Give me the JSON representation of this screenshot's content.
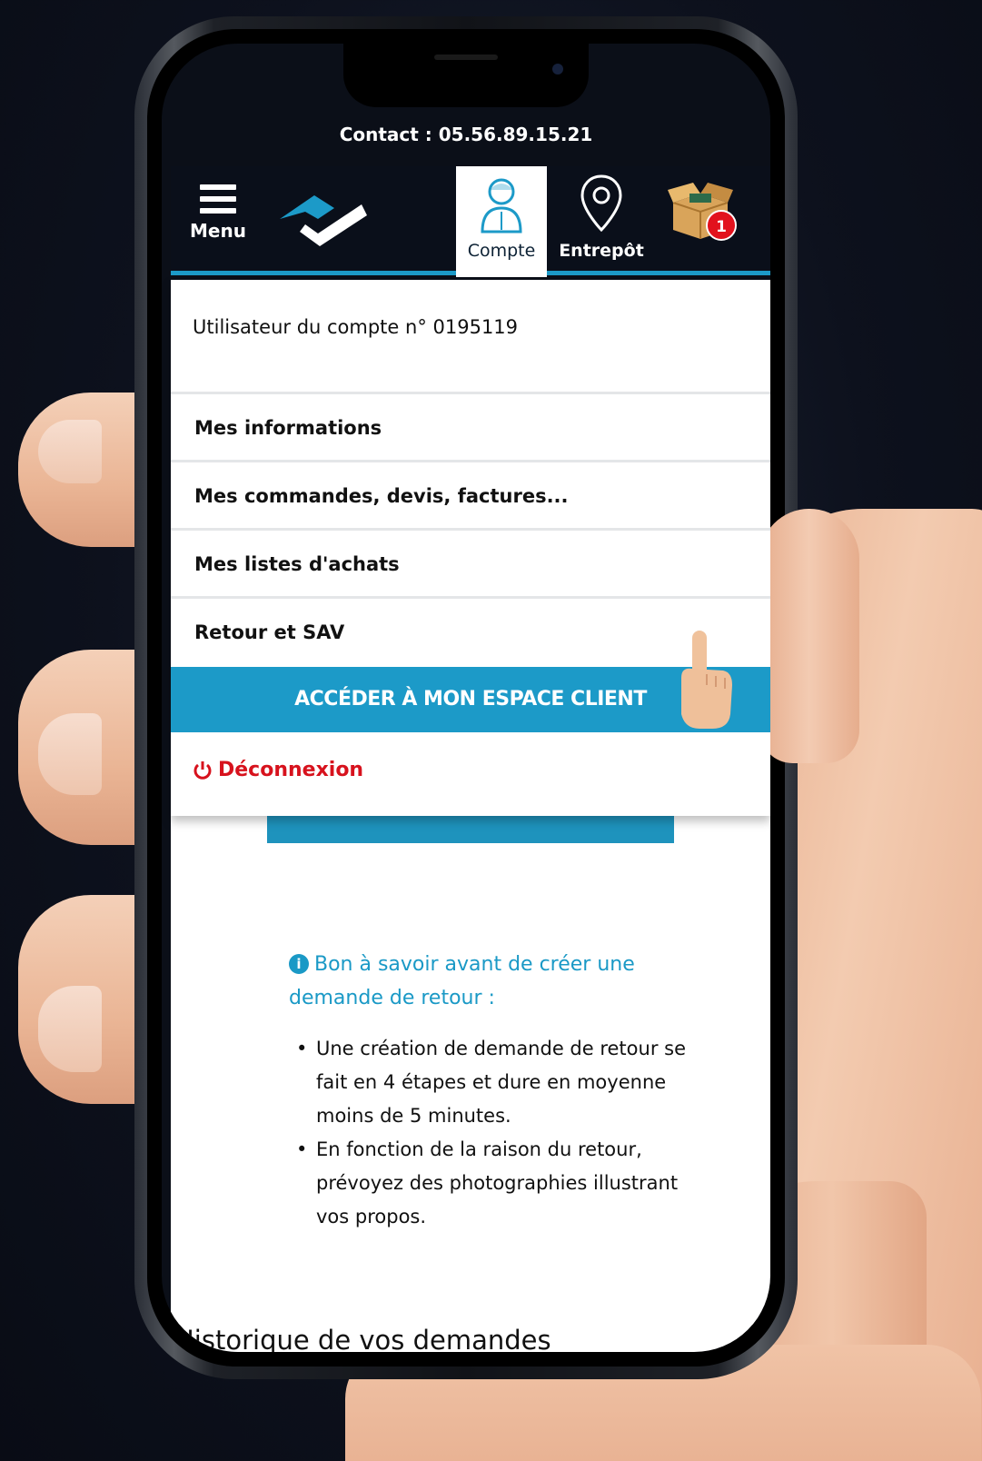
{
  "contact": "Contact : 05.56.89.15.21",
  "header": {
    "menu_label": "Menu",
    "tab_account_label": "Compte",
    "tab_warehouse_label": "Entrepôt",
    "cart_count": "1"
  },
  "dropdown": {
    "account_user": "Utilisateur du compte n° 0195119",
    "items": [
      {
        "label": "Mes informations"
      },
      {
        "label": "Mes commandes, devis, factures..."
      },
      {
        "label": "Mes listes d'achats"
      },
      {
        "label": "Retour et SAV"
      }
    ],
    "cta_label": "ACCÉDER À MON ESPACE CLIENT",
    "logout_label": "Déconnexion"
  },
  "info": {
    "title": "Bon à savoir avant de créer une demande de retour :",
    "bullets": [
      "Une création de demande de retour se fait en 4 étapes et dure en moyenne moins de 5 minutes.",
      "En fonction de la raison du retour, prévoyez des photographies illustrant vos propos."
    ]
  },
  "history_title": "Historique de vos demandes",
  "colors": {
    "accent": "#1c9ac8",
    "header_bg": "#0a0f1a",
    "logout": "#d7121d",
    "badge": "#e2121d"
  },
  "icons": {
    "menu": "hamburger-icon",
    "account": "user-icon",
    "warehouse": "location-pin-icon",
    "cart": "open-box-icon",
    "logout": "power-icon",
    "info": "info-icon",
    "pointer": "pointing-hand-icon"
  }
}
